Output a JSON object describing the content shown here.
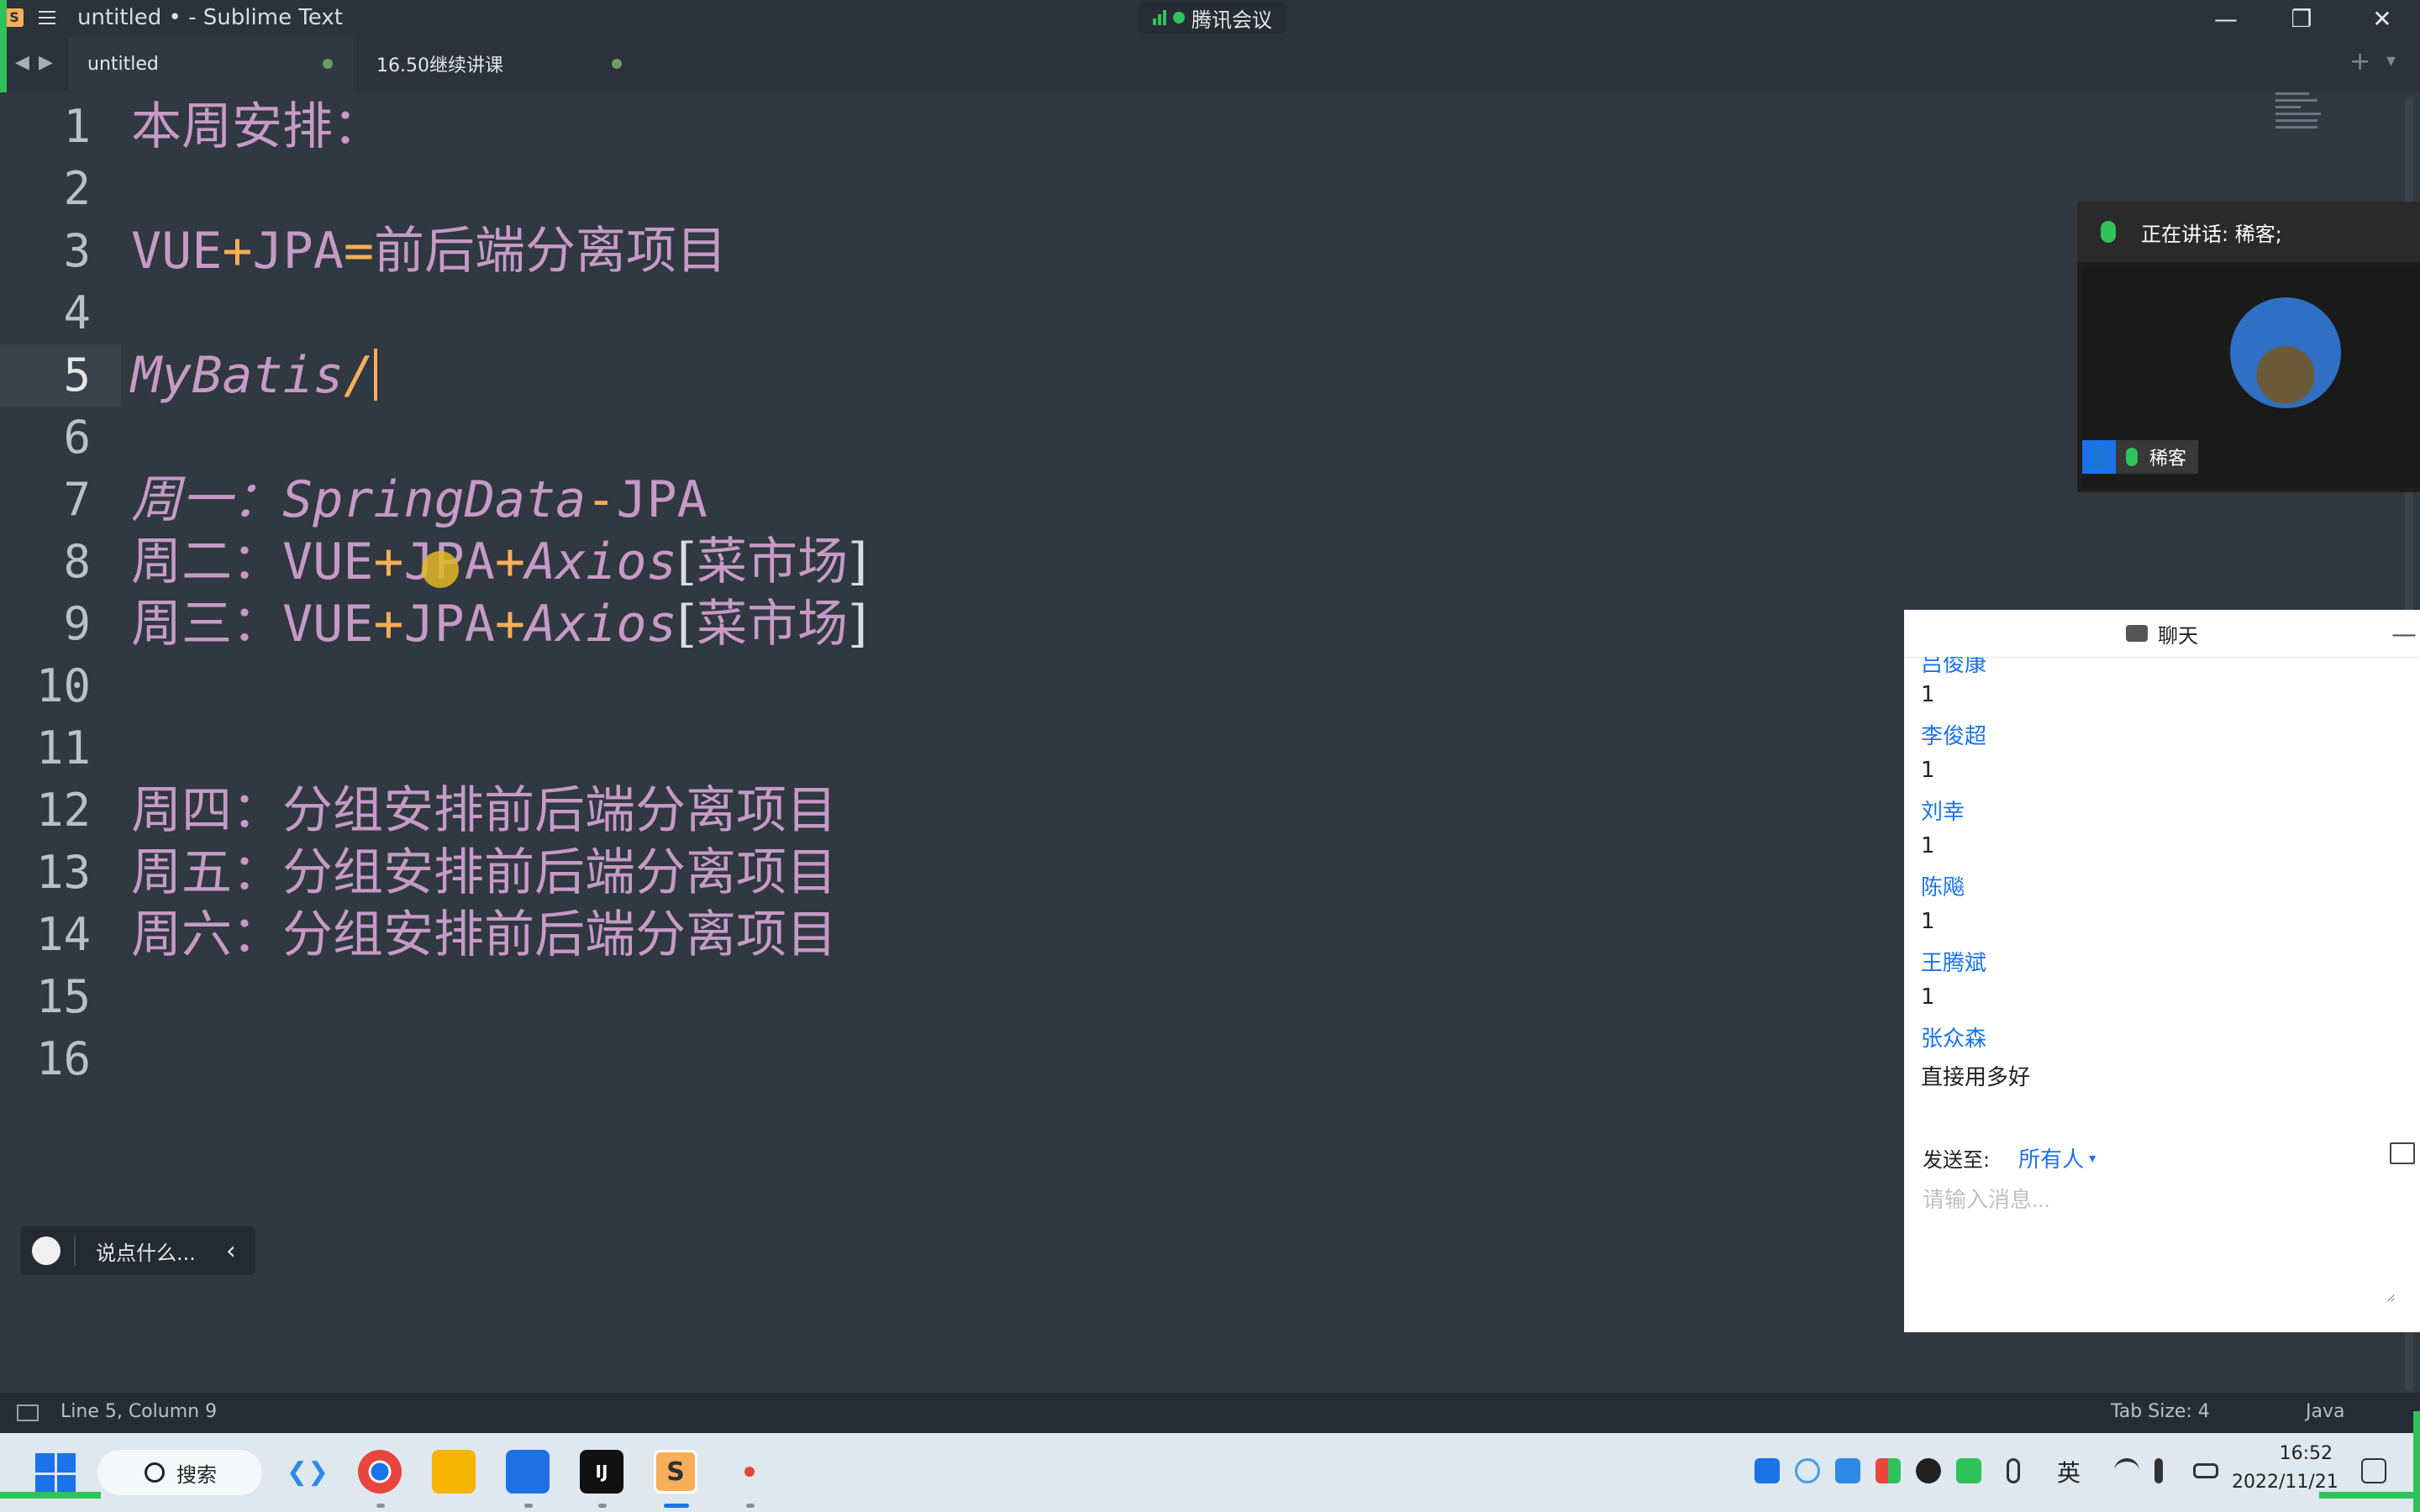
{
  "window": {
    "title": "untitled • - Sublime Text"
  },
  "meeting": {
    "name": "腾讯会议"
  },
  "window_controls": {
    "minimize": "—",
    "maximize": "❐",
    "close": "✕"
  },
  "tabs": [
    {
      "label": "untitled"
    },
    {
      "label": "16.50继续讲课"
    }
  ],
  "tab_actions": {
    "new_tab": "+",
    "tab_list": "▾"
  },
  "nav": {
    "back": "◀",
    "forward": "▶"
  },
  "editor": {
    "line_numbers": [
      "1",
      "2",
      "3",
      "4",
      "5",
      "6",
      "7",
      "8",
      "9",
      "10",
      "11",
      "12",
      "13",
      "14",
      "15",
      "16"
    ],
    "current_line": 5,
    "lines": {
      "l1": {
        "text": "本周安排："
      },
      "l3": {
        "a": "VUE",
        "b": "+",
        "c": "JPA",
        "d": "=",
        "e": "前后端分离项目"
      },
      "l5": {
        "a": "MyBatis",
        "b": "/"
      },
      "l7": {
        "a": "周一：",
        "b": "SpringData",
        "c": "-",
        "d": "JPA"
      },
      "l8": {
        "a": "周二：",
        "b": "VUE",
        "c": "+",
        "d": "JPA",
        "e": "+",
        "f": "Axios",
        "g": "[",
        "h": "菜市场",
        "i": "]"
      },
      "l9": {
        "a": "周三：",
        "b": "VUE",
        "c": "+",
        "d": "JPA",
        "e": "+",
        "f": "Axios",
        "g": "[",
        "h": "菜市场",
        "i": "]"
      },
      "l12": {
        "a": "周四：",
        "b": "分组安排前后端分离项目"
      },
      "l13": {
        "a": "周五：",
        "b": "分组安排前后端分离项目"
      },
      "l14": {
        "a": "周六：",
        "b": "分组安排前后端分离项目"
      }
    }
  },
  "speaker": {
    "status": "正在讲话: 稀客;",
    "name": "稀客",
    "user_icon": "👤"
  },
  "chat": {
    "title": "聊天",
    "minimize": "—",
    "messages": [
      {
        "sender": "吕俊康",
        "text": "1"
      },
      {
        "sender": "李俊超",
        "text": "1"
      },
      {
        "sender": "刘幸",
        "text": "1"
      },
      {
        "sender": "陈飚",
        "text": "1"
      },
      {
        "sender": "王腾斌",
        "text": "1"
      },
      {
        "sender": "张众森",
        "text": "直接用多好"
      }
    ],
    "send_to_label": "发送至:",
    "send_to_target": "所有人",
    "caret": "▾",
    "input_placeholder": "请输入消息..."
  },
  "reaction_bar": {
    "placeholder": "说点什么...",
    "collapse": "‹"
  },
  "statusbar": {
    "position": "Line 5, Column 9",
    "tab_size": "Tab Size: 4",
    "syntax": "Java"
  },
  "taskbar": {
    "search_label": "搜索",
    "ime_label": "英",
    "time": "16:52",
    "date": "2022/11/21"
  },
  "colors": {
    "accent": "#f9ae58",
    "editor_bg": "#303841",
    "meeting_green": "#2fc25b",
    "link_blue": "#1a73e8"
  }
}
